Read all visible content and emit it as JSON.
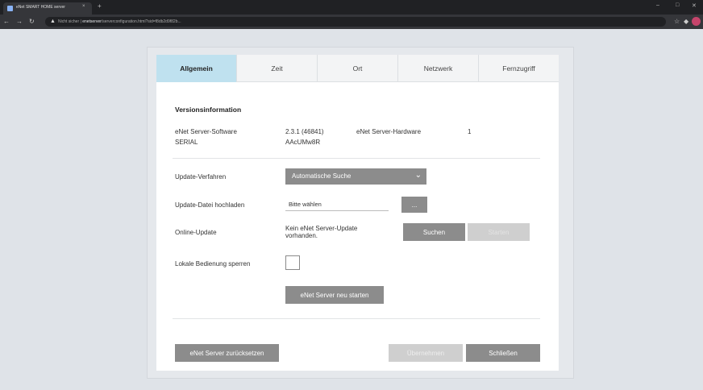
{
  "browser": {
    "tab_title": "eNet SMART HOME server",
    "tab_close": "×",
    "new_tab": "+",
    "warning": "Nicht sicher",
    "url_host": "enetserver",
    "url_path": "/serverconfiguration.html?sid=f8db2d9f82b..."
  },
  "tabs": [
    "Allgemein",
    "Zeit",
    "Ort",
    "Netzwerk",
    "Fernzugriff"
  ],
  "version": {
    "heading": "Versionsinformation",
    "software_label": "eNet Server-Software",
    "software_value": "2.3.1 (46841)",
    "hardware_label": "eNet Server-Hardware",
    "hardware_value": "1",
    "serial_label": "SERIAL",
    "serial_value": "AAcUMw8R"
  },
  "update": {
    "method_label": "Update-Verfahren",
    "method_value": "Automatische Suche",
    "upload_label": "Update-Datei hochladen",
    "upload_placeholder": "Bitte wählen",
    "browse_label": "...",
    "online_label": "Online-Update",
    "online_status_1": "Kein eNet Server-Update",
    "online_status_2": "vorhanden.",
    "search_button": "Suchen",
    "install_button": "Starten"
  },
  "local": {
    "lock_label": "Lokale Bedienung sperren",
    "restart_button": "eNet Server neu starten"
  },
  "footer": {
    "reset_button": "eNet Server zurücksetzen",
    "apply_button": "Übernehmen",
    "close_button": "Schließen"
  }
}
